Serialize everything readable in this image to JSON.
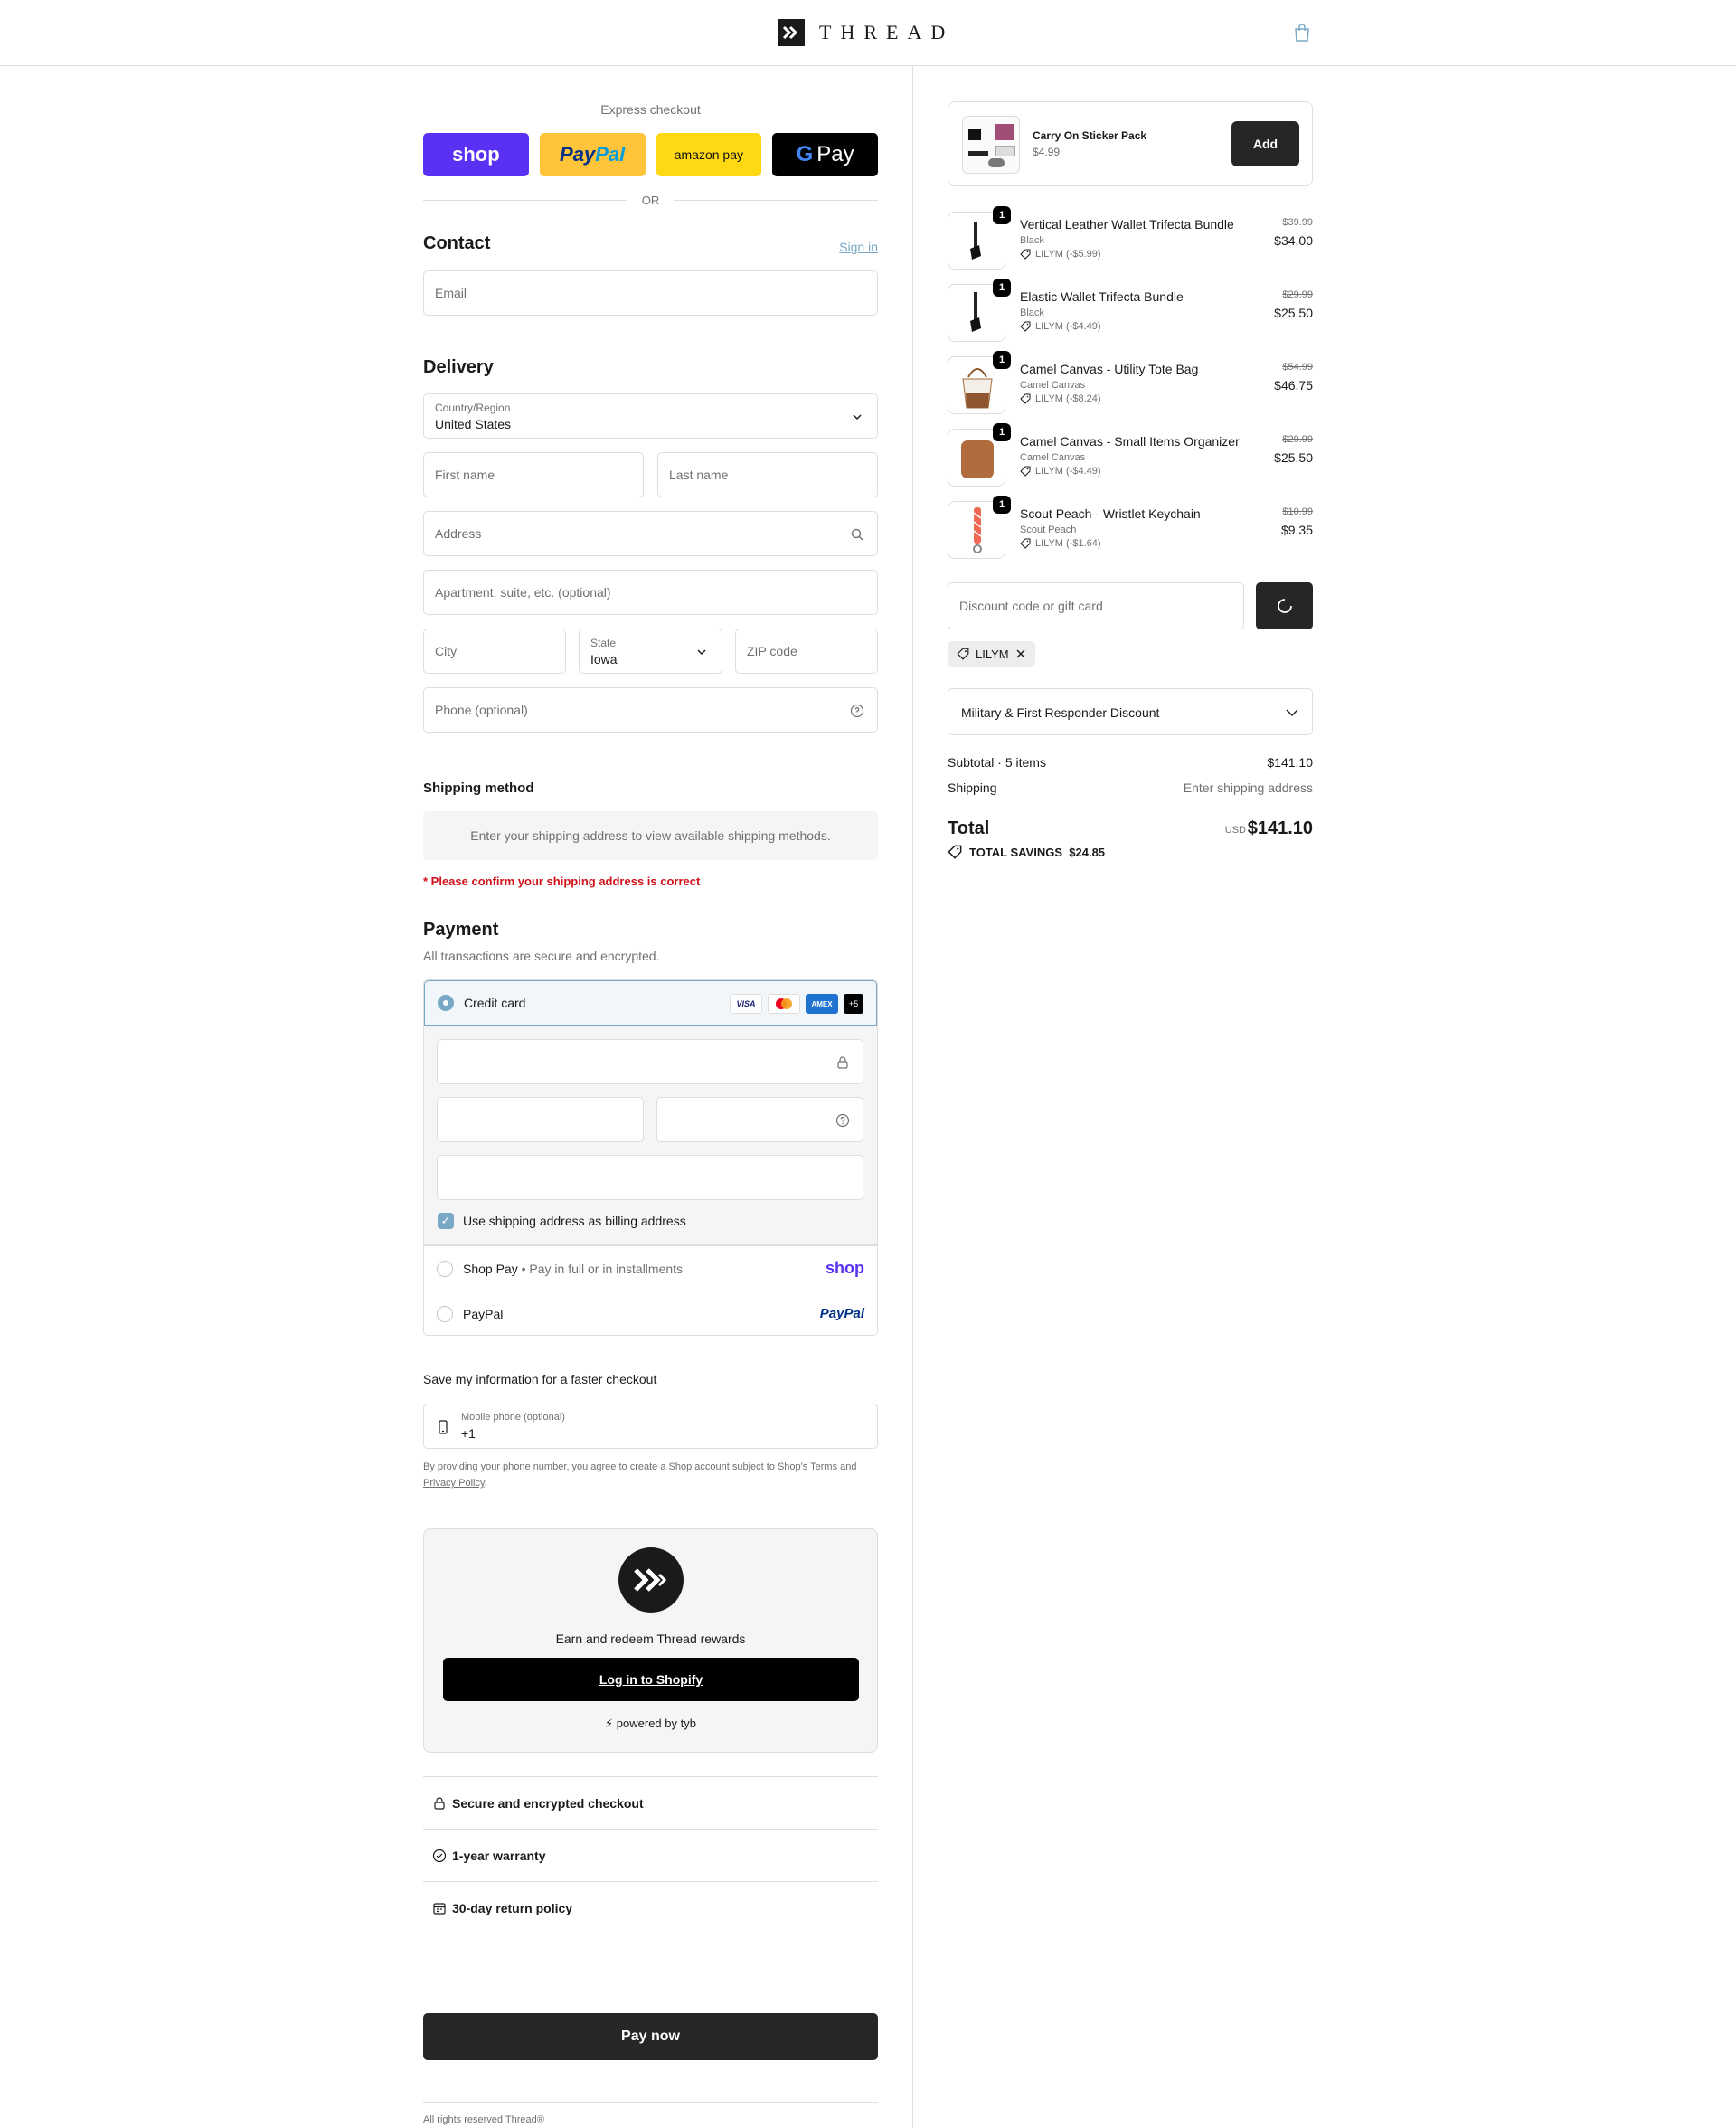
{
  "header": {
    "brand": "THREAD"
  },
  "express": {
    "title": "Express checkout",
    "buttons": {
      "shop": "shop",
      "paypal_a": "Pay",
      "paypal_b": "Pal",
      "amazon": "amazon pay",
      "gpay": "Pay"
    },
    "or": "OR"
  },
  "contact": {
    "title": "Contact",
    "sign_in": "Sign in",
    "email_placeholder": "Email"
  },
  "delivery": {
    "title": "Delivery",
    "country_label": "Country/Region",
    "country_value": "United States",
    "first_name": "First name",
    "last_name": "Last name",
    "address": "Address",
    "apartment": "Apartment, suite, etc. (optional)",
    "city": "City",
    "state_label": "State",
    "state_value": "Iowa",
    "zip": "ZIP code",
    "phone": "Phone (optional)"
  },
  "shipping": {
    "title": "Shipping method",
    "message": "Enter your shipping address to view available shipping methods.",
    "warning": "* Please confirm your shipping address is correct"
  },
  "payment": {
    "title": "Payment",
    "subtitle": "All transactions are secure and encrypted.",
    "credit_card": "Credit card",
    "card_logos": {
      "visa": "VISA",
      "amex": "AMEX",
      "more": "+5"
    },
    "billing_same": "Use shipping address as billing address",
    "shop_pay": "Shop Pay",
    "shop_pay_note": "Pay in full or in installments",
    "shop_pay_logo": "shop",
    "paypal": "PayPal",
    "paypal_logo": "PayPal"
  },
  "save_info": {
    "title": "Save my information for a faster checkout",
    "mobile_label": "Mobile phone (optional)",
    "mobile_value": "+1",
    "legal_prefix": "By providing your phone number, you agree to create a Shop account subject to Shop's",
    "terms": "Terms",
    "and": "and",
    "privacy": "Privacy Policy"
  },
  "rewards": {
    "text": "Earn and redeem Thread rewards",
    "button": "Log in to Shopify",
    "powered": "⚡ powered by tyb"
  },
  "trust": [
    "Secure and encrypted checkout",
    "1-year warranty",
    "30-day return policy"
  ],
  "pay_now": "Pay now",
  "footer": "All rights reserved Thread®",
  "upsell": {
    "name": "Carry On Sticker Pack",
    "price": "$4.99",
    "button": "Add"
  },
  "items": [
    {
      "qty": "1",
      "name": "Vertical Leather Wallet Trifecta Bundle",
      "variant": "Black",
      "discount": "LILYM (-$5.99)",
      "orig": "$39.99",
      "price": "$34.00"
    },
    {
      "qty": "1",
      "name": "Elastic Wallet Trifecta Bundle",
      "variant": "Black",
      "discount": "LILYM (-$4.49)",
      "orig": "$29.99",
      "price": "$25.50"
    },
    {
      "qty": "1",
      "name": "Camel Canvas - Utility Tote Bag",
      "variant": "Camel Canvas",
      "discount": "LILYM (-$8.24)",
      "orig": "$54.99",
      "price": "$46.75"
    },
    {
      "qty": "1",
      "name": "Camel Canvas - Small Items Organizer",
      "variant": "Camel Canvas",
      "discount": "LILYM (-$4.49)",
      "orig": "$29.99",
      "price": "$25.50"
    },
    {
      "qty": "1",
      "name": "Scout Peach - Wristlet Keychain",
      "variant": "Scout Peach",
      "discount": "LILYM (-$1.64)",
      "orig": "$10.99",
      "price": "$9.35"
    }
  ],
  "discount": {
    "placeholder": "Discount code or gift card",
    "applied": "LILYM"
  },
  "military": "Military & First Responder Discount",
  "summary": {
    "subtotal_label": "Subtotal · 5 items",
    "subtotal": "$141.10",
    "shipping_label": "Shipping",
    "shipping": "Enter shipping address",
    "total_label": "Total",
    "currency": "USD",
    "total": "$141.10",
    "savings": "TOTAL SAVINGS  $24.85"
  }
}
